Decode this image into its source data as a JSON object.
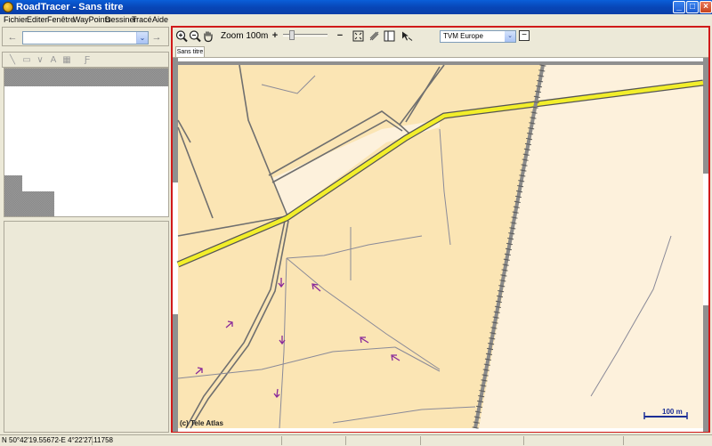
{
  "window": {
    "title": "RoadTracer - Sans titre",
    "minimize_glyph": "_",
    "maximize_glyph": "□",
    "close_glyph": "×"
  },
  "menu": [
    {
      "label": "Fichier"
    },
    {
      "label": "Editer"
    },
    {
      "label": "Fenêtre"
    },
    {
      "label": "WayPoints"
    },
    {
      "label": "Dessiner"
    },
    {
      "label": "Tracé"
    },
    {
      "label": "Aide"
    }
  ],
  "left_panel": {
    "back_glyph": "←",
    "forward_glyph": "→",
    "combo_value": "",
    "combo_arrow": "⌄",
    "draw_tools": [
      "╲",
      "▭",
      "∨",
      "A",
      "▦",
      "Ƒ"
    ]
  },
  "map_toolbar": {
    "zoom_label": "Zoom 100m",
    "zoom_plus": "+",
    "zoom_minus": "−",
    "map_source": "TVM Europe",
    "select_arrow": "⌄",
    "collapse_glyph": "−",
    "zoom_slider_position": 0.15
  },
  "tabs": [
    {
      "label": "Sans titre"
    }
  ],
  "map": {
    "copyright": "(c) Tele Atlas",
    "scale_label": "100 m",
    "colors": {
      "land": "#fbe5b4",
      "land_light": "#fdf1dc",
      "road_major": "#f2ee2a",
      "rail": "#8a8a8a",
      "track": "#7a6a88",
      "arrow": "#8a2a9a"
    }
  },
  "status": {
    "coordinates": "N 50°42'19.55672-E   4°22'27.11758"
  },
  "icons": {
    "zoom_in": "zoom-in-icon",
    "zoom_out": "zoom-out-icon",
    "pan": "hand-pan-icon",
    "fit": "fit-window-icon",
    "track_tool": "track-tool-icon",
    "panel": "panel-icon",
    "cursor": "cursor-route-icon"
  }
}
